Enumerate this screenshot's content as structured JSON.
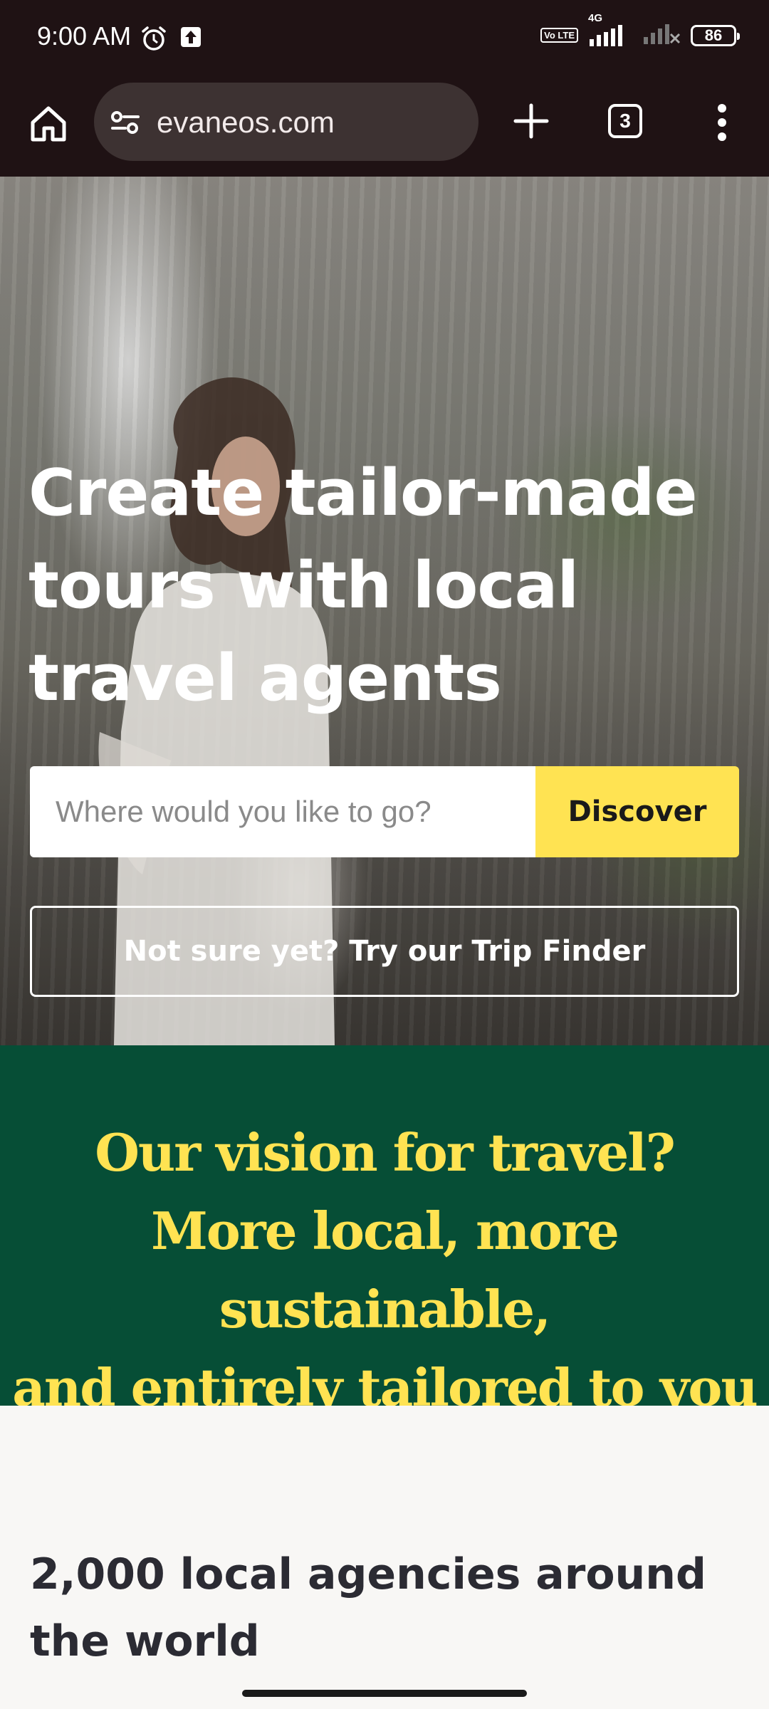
{
  "status_bar": {
    "time": "9:00 AM",
    "network": "4G",
    "volte": "Vo LTE",
    "battery": "86"
  },
  "browser": {
    "url": "evaneos.com",
    "tab_count": "3"
  },
  "hero": {
    "title": "Create tailor-made tours with local travel agents",
    "search_placeholder": "Where would you like to go?",
    "discover_label": "Discover",
    "trip_finder_label": "Not sure yet? Try our Trip Finder"
  },
  "vision": {
    "lines": [
      "Our vision for travel?",
      "More local, more sustainable,",
      "and entirely tailored to you"
    ]
  },
  "agencies": {
    "title": "2,000 local agencies around the world"
  },
  "colors": {
    "browser_bg": "#1f1214",
    "accent_yellow": "#ffe352",
    "vision_green": "#064e36"
  }
}
